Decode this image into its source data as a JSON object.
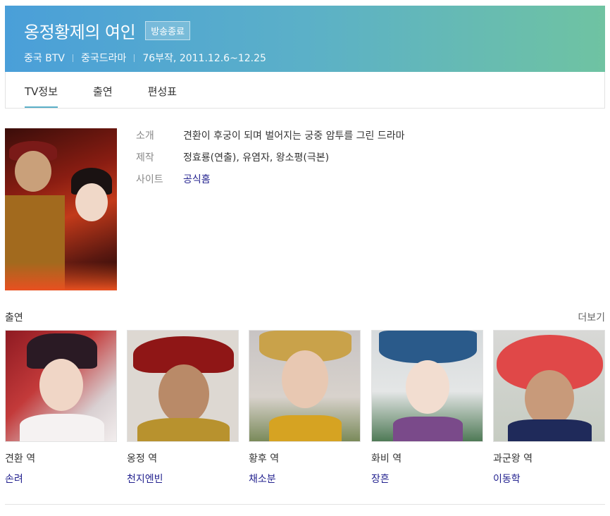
{
  "header": {
    "title": "옹정황제의 여인",
    "badge": "방송종료",
    "meta": [
      "중국 BTV",
      "중국드라마",
      "76부작, 2011.12.6~12.25"
    ]
  },
  "tabs": [
    {
      "label": "TV정보",
      "active": true
    },
    {
      "label": "출연",
      "active": false
    },
    {
      "label": "편성표",
      "active": false
    }
  ],
  "info": {
    "intro_label": "소개",
    "intro_value": "견환이 후궁이 되며 벌어지는 궁중 암투를 그린 드라마",
    "production_label": "제작",
    "production_value": "정효룡(연출), 유염자, 왕소평(극본)",
    "site_label": "사이트",
    "site_value": "공식홈"
  },
  "cast": {
    "title": "출연",
    "more": "더보기",
    "members": [
      {
        "role": "견환 역",
        "actor": "손려"
      },
      {
        "role": "옹정 역",
        "actor": "천지엔빈"
      },
      {
        "role": "황후 역",
        "actor": "채소분"
      },
      {
        "role": "화비 역",
        "actor": "장흔"
      },
      {
        "role": "과군왕 역",
        "actor": "이동학"
      }
    ]
  },
  "colors": {
    "header_gradient_start": "#4a9fd9",
    "header_gradient_end": "#6fc3a2",
    "link": "#23228f",
    "tab_active_underline": "#5bb0c8"
  }
}
